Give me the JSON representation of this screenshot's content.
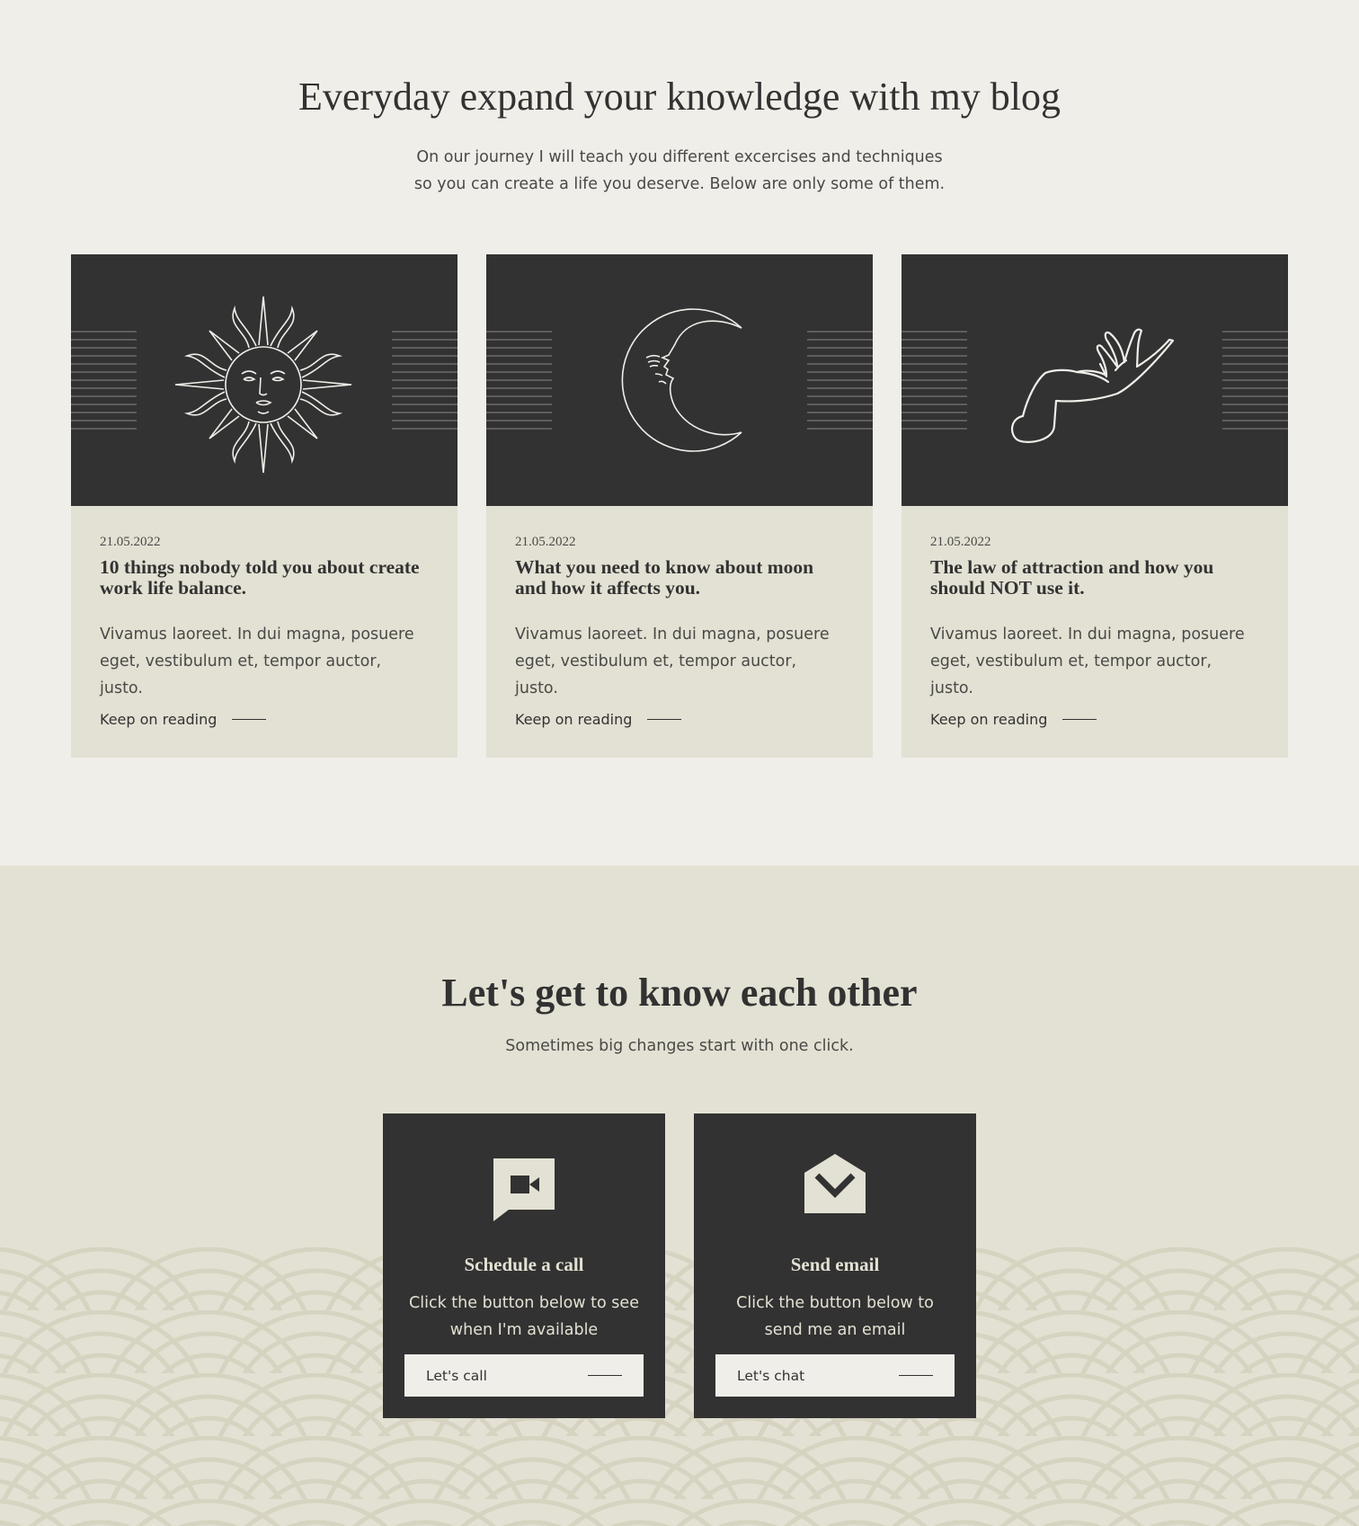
{
  "blog": {
    "title": "Everyday expand your knowledge with my blog",
    "subtitle_line1": "On our journey I will teach you different excercises and techniques",
    "subtitle_line2": "so you can create a life you deserve. Below are only some of them.",
    "posts": [
      {
        "icon": "sun-face-icon",
        "date": "21.05.2022",
        "title": "10 things nobody told you about create work life balance.",
        "excerpt": "Vivamus laoreet. In dui magna, posuere eget, vestibulum et, tempor auctor, justo.",
        "link": "Keep on reading"
      },
      {
        "icon": "crescent-moon-face-icon",
        "date": "21.05.2022",
        "title": "What you need to know about moon and how it affects you.",
        "excerpt": "Vivamus laoreet. In dui magna, posuere eget, vestibulum et, tempor auctor, justo.",
        "link": "Keep on reading"
      },
      {
        "icon": "hand-icon",
        "date": "21.05.2022",
        "title": "The law of attraction and how you should NOT use it.",
        "excerpt": "Vivamus laoreet. In dui magna, posuere eget, vestibulum et, tempor auctor, justo.",
        "link": "Keep on reading"
      }
    ]
  },
  "contact": {
    "title": "Let's get to know each other",
    "subtitle": "Sometimes big changes start with one click.",
    "boxes": [
      {
        "icon": "video-chat-icon",
        "title": "Schedule a call",
        "text_line1": "Click the button below to see",
        "text_line2": "when I'm available",
        "button": "Let's call"
      },
      {
        "icon": "envelope-icon",
        "title": "Send email",
        "text_line1": "Click the button below to",
        "text_line2": "send me an email",
        "button": "Let's chat"
      }
    ]
  },
  "colors": {
    "page_bg": "#f0eee9",
    "card_bg": "#e3e1d3",
    "dark": "#333232"
  }
}
